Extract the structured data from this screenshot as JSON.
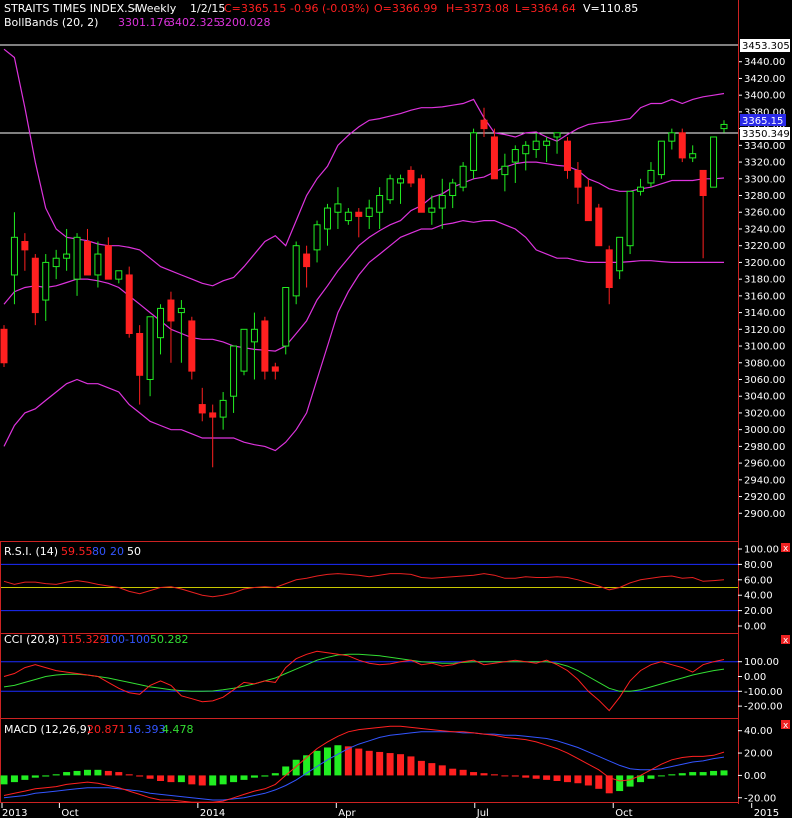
{
  "header": {
    "symbol": "STRAITS TIMES INDEX.SI",
    "period": "-Weekly",
    "date": "1/2/15",
    "close": "C=3365.15",
    "change": "-0.96 (-0.03%)",
    "open": "O=3366.99",
    "high": "H=3373.08",
    "low": "L=3364.64",
    "volume": "V=110.85"
  },
  "boll_header": {
    "label": "BollBands (20, 2)",
    "middle": "3301.176",
    "upper": "3402.325",
    "lower": "3200.028"
  },
  "rsi_header": {
    "label": "R.S.I. (14)",
    "value": "59.55",
    "upper": "80",
    "lower": "20",
    "mid": "50"
  },
  "cci_header": {
    "label": "CCI (20,8)",
    "value": "115.329",
    "upper": "100",
    "lower": "-100",
    "signal": "50.282"
  },
  "macd_header": {
    "label": "MACD (12,26,9)",
    "macd": "20.871",
    "signal": "16.393",
    "hist": "4.478"
  },
  "price_markers": {
    "high_line": "3453.305",
    "last": "3365.15",
    "ref_line": "3350.349"
  },
  "close_box": "x",
  "colors": {
    "up": "#22ee22",
    "down": "#ff2020",
    "boll": "#dd33dd",
    "rsi": "#e82020",
    "cci": "#ff2020",
    "cci_signal": "#33dd33",
    "macd": "#ff2020",
    "macd_signal": "#3355ff",
    "level_blue": "#1c2cff",
    "level_yellow": "#c8c800",
    "frame": "#cc2222",
    "last_bg": "#2a2ae8"
  },
  "chart_data": [
    {
      "type": "candlestick",
      "title": "STRAITS TIMES INDEX.SI -Weekly",
      "x_ticks": [
        "2013",
        "Oct",
        "2014",
        "Apr",
        "Jul",
        "Oct",
        "2015"
      ],
      "ylim": [
        2880,
        3460
      ],
      "y_ticks": [
        "3440.00",
        "3420.00",
        "3400.00",
        "3380.00",
        "3360.00",
        "3340.00",
        "3320.00",
        "3300.00",
        "3280.00",
        "3260.00",
        "3240.00",
        "3220.00",
        "3200.00",
        "3180.00",
        "3160.00",
        "3140.00",
        "3120.00",
        "3100.00",
        "3080.00",
        "3060.00",
        "3040.00",
        "3020.00",
        "3000.00",
        "2980.00",
        "2960.00",
        "2940.00",
        "2920.00",
        "2900.00"
      ],
      "ohlc": [
        [
          3120,
          3125,
          3075,
          3080
        ],
        [
          3185,
          3260,
          3150,
          3230
        ],
        [
          3225,
          3235,
          3190,
          3215
        ],
        [
          3205,
          3210,
          3125,
          3140
        ],
        [
          3155,
          3210,
          3130,
          3200
        ],
        [
          3195,
          3215,
          3180,
          3205
        ],
        [
          3205,
          3240,
          3190,
          3210
        ],
        [
          3180,
          3235,
          3160,
          3230
        ],
        [
          3225,
          3240,
          3185,
          3185
        ],
        [
          3185,
          3225,
          3170,
          3210
        ],
        [
          3220,
          3230,
          3180,
          3180
        ],
        [
          3180,
          3190,
          3175,
          3190
        ],
        [
          3185,
          3195,
          3110,
          3115
        ],
        [
          3115,
          3125,
          3030,
          3065
        ],
        [
          3060,
          3120,
          3040,
          3135
        ],
        [
          3110,
          3150,
          3090,
          3145
        ],
        [
          3155,
          3165,
          3080,
          3130
        ],
        [
          3140,
          3155,
          3080,
          3145
        ],
        [
          3130,
          3135,
          3060,
          3070
        ],
        [
          3030,
          3050,
          3010,
          3020
        ],
        [
          3020,
          3030,
          2955,
          3015
        ],
        [
          3015,
          3045,
          3000,
          3035
        ],
        [
          3040,
          3100,
          3020,
          3100
        ],
        [
          3070,
          3110,
          3065,
          3120
        ],
        [
          3105,
          3140,
          3060,
          3120
        ],
        [
          3130,
          3135,
          3060,
          3070
        ],
        [
          3075,
          3080,
          3060,
          3070
        ],
        [
          3100,
          3170,
          3090,
          3170
        ],
        [
          3160,
          3225,
          3150,
          3220
        ],
        [
          3210,
          3220,
          3170,
          3195
        ],
        [
          3215,
          3250,
          3200,
          3245
        ],
        [
          3240,
          3270,
          3220,
          3265
        ],
        [
          3260,
          3290,
          3240,
          3270
        ],
        [
          3250,
          3265,
          3245,
          3260
        ],
        [
          3260,
          3265,
          3230,
          3255
        ],
        [
          3255,
          3275,
          3240,
          3265
        ],
        [
          3260,
          3290,
          3240,
          3280
        ],
        [
          3275,
          3305,
          3270,
          3300
        ],
        [
          3295,
          3305,
          3270,
          3300
        ],
        [
          3310,
          3315,
          3290,
          3295
        ],
        [
          3300,
          3305,
          3260,
          3260
        ],
        [
          3260,
          3280,
          3245,
          3265
        ],
        [
          3265,
          3300,
          3240,
          3280
        ],
        [
          3280,
          3300,
          3265,
          3295
        ],
        [
          3290,
          3320,
          3285,
          3315
        ],
        [
          3310,
          3360,
          3300,
          3355
        ],
        [
          3370,
          3385,
          3350,
          3360
        ],
        [
          3350,
          3360,
          3300,
          3300
        ],
        [
          3305,
          3330,
          3285,
          3315
        ],
        [
          3320,
          3340,
          3295,
          3335
        ],
        [
          3330,
          3345,
          3310,
          3340
        ],
        [
          3335,
          3355,
          3325,
          3345
        ],
        [
          3340,
          3350,
          3320,
          3345
        ],
        [
          3350,
          3355,
          3330,
          3355
        ],
        [
          3345,
          3350,
          3300,
          3310
        ],
        [
          3310,
          3320,
          3270,
          3290
        ],
        [
          3290,
          3300,
          3250,
          3250
        ],
        [
          3265,
          3270,
          3220,
          3220
        ],
        [
          3215,
          3220,
          3150,
          3170
        ],
        [
          3190,
          3230,
          3180,
          3230
        ],
        [
          3220,
          3280,
          3210,
          3285
        ],
        [
          3285,
          3300,
          3280,
          3290
        ],
        [
          3295,
          3320,
          3290,
          3310
        ],
        [
          3305,
          3330,
          3300,
          3345
        ],
        [
          3345,
          3360,
          3335,
          3355
        ],
        [
          3355,
          3360,
          3320,
          3325
        ],
        [
          3325,
          3340,
          3320,
          3330
        ],
        [
          3310,
          3310,
          3205,
          3280
        ],
        [
          3290,
          3300,
          3290,
          3350
        ],
        [
          3360,
          3370,
          3355,
          3365
        ]
      ],
      "bollinger": {
        "upper": [
          3455,
          3445,
          3385,
          3320,
          3265,
          3240,
          3230,
          3228,
          3226,
          3222,
          3220,
          3220,
          3218,
          3215,
          3205,
          3195,
          3190,
          3185,
          3180,
          3175,
          3172,
          3178,
          3182,
          3195,
          3210,
          3225,
          3232,
          3220,
          3250,
          3280,
          3300,
          3315,
          3340,
          3352,
          3362,
          3370,
          3372,
          3375,
          3378,
          3382,
          3385,
          3385,
          3386,
          3388,
          3390,
          3395,
          3373,
          3355,
          3353,
          3350,
          3355,
          3356,
          3350,
          3345,
          3353,
          3360,
          3365,
          3367,
          3368,
          3370,
          3372,
          3385,
          3390,
          3390,
          3395,
          3390,
          3395,
          3398,
          3400,
          3402
        ],
        "middle": [
          3150,
          3165,
          3170,
          3172,
          3170,
          3172,
          3176,
          3180,
          3180,
          3178,
          3175,
          3170,
          3160,
          3150,
          3140,
          3130,
          3120,
          3115,
          3110,
          3108,
          3108,
          3105,
          3100,
          3098,
          3096,
          3095,
          3094,
          3100,
          3115,
          3130,
          3155,
          3172,
          3190,
          3205,
          3220,
          3230,
          3238,
          3245,
          3250,
          3262,
          3268,
          3278,
          3282,
          3290,
          3295,
          3300,
          3302,
          3308,
          3314,
          3318,
          3320,
          3320,
          3318,
          3316,
          3315,
          3310,
          3300,
          3295,
          3288,
          3285,
          3285,
          3288,
          3290,
          3294,
          3298,
          3298,
          3298,
          3300,
          3300,
          3301
        ],
        "lower": [
          2980,
          3005,
          3020,
          3025,
          3035,
          3045,
          3055,
          3060,
          3055,
          3055,
          3050,
          3045,
          3030,
          3020,
          3010,
          3005,
          3000,
          3000,
          2995,
          2990,
          2990,
          2990,
          2990,
          2985,
          2982,
          2980,
          2975,
          2985,
          3000,
          3020,
          3060,
          3100,
          3140,
          3165,
          3185,
          3200,
          3210,
          3220,
          3230,
          3235,
          3240,
          3240,
          3245,
          3247,
          3250,
          3248,
          3250,
          3250,
          3245,
          3240,
          3230,
          3215,
          3210,
          3205,
          3205,
          3202,
          3200,
          3200,
          3200,
          3200,
          3201,
          3202,
          3202,
          3201,
          3200,
          3200,
          3200,
          3200,
          3200,
          3200
        ]
      }
    },
    {
      "type": "line",
      "title": "R.S.I. (14)",
      "ylim": [
        0,
        100
      ],
      "y_ticks": [
        "100.00",
        "80.00",
        "60.00",
        "40.00",
        "20.00",
        "0.00"
      ],
      "levels": [
        80,
        50,
        20
      ],
      "values": [
        58,
        54,
        57,
        57,
        55,
        54,
        57,
        59,
        57,
        54,
        52,
        50,
        45,
        42,
        46,
        50,
        51,
        48,
        44,
        40,
        38,
        40,
        43,
        48,
        50,
        51,
        50,
        55,
        60,
        62,
        65,
        67,
        68,
        67,
        66,
        64,
        66,
        68,
        68,
        67,
        63,
        62,
        63,
        64,
        65,
        66,
        68,
        66,
        62,
        62,
        64,
        63,
        63,
        64,
        63,
        60,
        56,
        52,
        47,
        50,
        56,
        60,
        62,
        64,
        65,
        62,
        63,
        58,
        59,
        60
      ]
    },
    {
      "type": "line",
      "title": "CCI (20,8)",
      "ylim": [
        -260,
        260
      ],
      "y_ticks": [
        "100.00",
        "0.00",
        "-100.00",
        "-200.00"
      ],
      "levels": [
        100,
        -100
      ],
      "series": [
        {
          "name": "CCI",
          "values": [
            0,
            20,
            60,
            80,
            60,
            40,
            30,
            20,
            10,
            0,
            -40,
            -80,
            -110,
            -120,
            -60,
            -30,
            -60,
            -130,
            -150,
            -170,
            -165,
            -140,
            -90,
            -40,
            -50,
            -30,
            -40,
            60,
            120,
            150,
            170,
            160,
            150,
            140,
            110,
            90,
            80,
            85,
            100,
            110,
            80,
            90,
            70,
            80,
            100,
            110,
            80,
            90,
            100,
            110,
            100,
            90,
            110,
            80,
            40,
            -20,
            -100,
            -160,
            -230,
            -140,
            -30,
            40,
            80,
            100,
            80,
            60,
            30,
            80,
            100,
            115
          ]
        },
        {
          "name": "Signal",
          "values": [
            -70,
            -60,
            -40,
            -20,
            0,
            10,
            15,
            15,
            10,
            0,
            -10,
            -25,
            -40,
            -55,
            -70,
            -80,
            -90,
            -95,
            -100,
            -100,
            -98,
            -90,
            -80,
            -65,
            -50,
            -30,
            -10,
            20,
            50,
            80,
            110,
            130,
            145,
            150,
            150,
            145,
            140,
            130,
            120,
            110,
            100,
            95,
            90,
            90,
            95,
            100,
            100,
            100,
            100,
            100,
            100,
            100,
            100,
            90,
            70,
            40,
            0,
            -40,
            -80,
            -100,
            -100,
            -90,
            -70,
            -50,
            -30,
            -10,
            10,
            25,
            40,
            50
          ]
        }
      ]
    },
    {
      "type": "bar",
      "title": "MACD (12,26,9)",
      "ylim": [
        -22,
        46
      ],
      "y_ticks": [
        "40.00",
        "20.00",
        "0.00",
        "-20.00"
      ],
      "histogram": [
        -8,
        -6,
        -4,
        -2,
        -1,
        1,
        3,
        4,
        5,
        5,
        4,
        3,
        1,
        -1,
        -3,
        -5,
        -6,
        -6,
        -8,
        -9,
        -9,
        -8,
        -6,
        -4,
        -2,
        -1,
        2,
        8,
        14,
        18,
        22,
        25,
        27,
        26,
        24,
        22,
        21,
        20,
        19,
        17,
        13,
        11,
        9,
        6,
        5,
        3,
        2,
        1,
        0,
        -1,
        -2,
        -3,
        -4,
        -5,
        -6,
        -7,
        -9,
        -12,
        -16,
        -14,
        -10,
        -6,
        -3,
        0,
        1,
        2,
        3,
        3,
        4,
        4.5
      ],
      "series": [
        {
          "name": "MACD",
          "values": [
            -18,
            -16,
            -14,
            -12,
            -11,
            -10,
            -8,
            -7,
            -6,
            -7,
            -9,
            -11,
            -14,
            -17,
            -20,
            -22,
            -22,
            -23,
            -24,
            -24,
            -24,
            -23,
            -20,
            -17,
            -14,
            -12,
            -8,
            0,
            8,
            16,
            24,
            30,
            35,
            39,
            41,
            42,
            43,
            44,
            44,
            43,
            42,
            41,
            40,
            39,
            39,
            38,
            37,
            36,
            34,
            33,
            32,
            30,
            27,
            24,
            20,
            15,
            10,
            5,
            -2,
            -5,
            -4,
            0,
            5,
            10,
            14,
            16,
            17,
            17,
            18,
            20.9
          ]
        },
        {
          "name": "Signal",
          "values": [
            -20,
            -19,
            -18,
            -16,
            -15,
            -14,
            -13,
            -12,
            -11,
            -11,
            -11,
            -12,
            -13,
            -14,
            -16,
            -17,
            -18,
            -19,
            -20,
            -21,
            -22,
            -22,
            -21,
            -20,
            -18,
            -16,
            -13,
            -9,
            -4,
            2,
            8,
            14,
            19,
            24,
            28,
            31,
            34,
            36,
            37,
            38,
            39,
            39,
            39,
            39,
            38,
            38,
            37,
            37,
            36,
            36,
            35,
            34,
            33,
            31,
            28,
            25,
            21,
            17,
            13,
            9,
            6,
            5,
            5,
            6,
            8,
            10,
            12,
            13,
            15,
            16.4
          ]
        }
      ]
    }
  ]
}
